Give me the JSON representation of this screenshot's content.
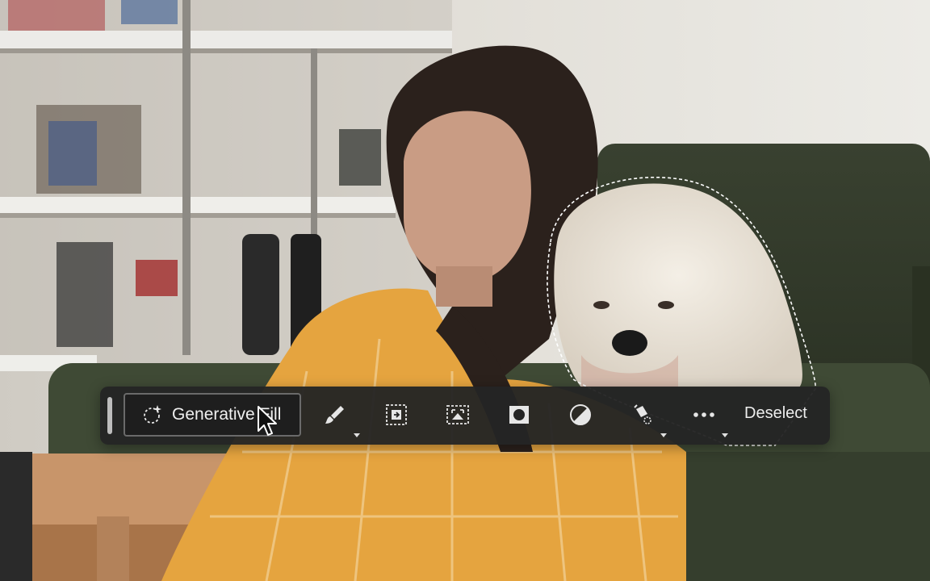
{
  "toolbar": {
    "generative_fill_label": "Generative Fill",
    "deselect_label": "Deselect",
    "tools": [
      {
        "icon": "brush-icon",
        "has_menu": true
      },
      {
        "icon": "invert-selection-icon",
        "has_menu": false
      },
      {
        "icon": "transform-selection-icon",
        "has_menu": false
      },
      {
        "icon": "mask-icon",
        "has_menu": false
      },
      {
        "icon": "adjustment-icon",
        "has_menu": false
      },
      {
        "icon": "fill-bucket-icon",
        "has_menu": true
      },
      {
        "icon": "more-icon",
        "has_menu": true
      }
    ]
  },
  "colors": {
    "toolbar_bg": "#242424",
    "text": "#f0f0f0",
    "shirt": "#e5a43f",
    "sofa": "#3e4834",
    "wall": "#e6e4df"
  }
}
